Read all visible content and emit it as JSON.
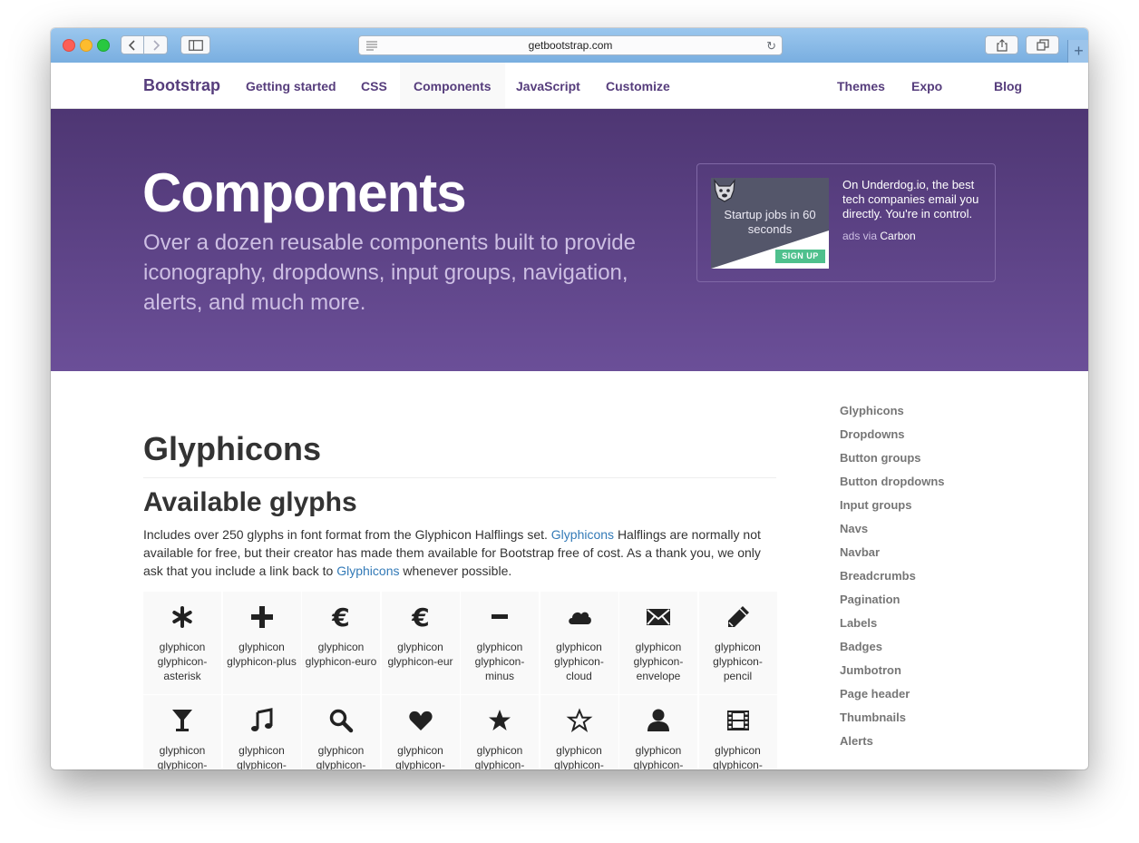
{
  "browser": {
    "url": "getbootstrap.com"
  },
  "navbar": {
    "brand": "Bootstrap",
    "left_items": [
      "Getting started",
      "CSS",
      "Components",
      "JavaScript",
      "Customize"
    ],
    "right_items": [
      "Themes",
      "Expo",
      "Blog"
    ],
    "active": "Components"
  },
  "hero": {
    "title": "Components",
    "lead": "Over a dozen reusable components built to provide iconography, dropdowns, input groups, navigation, alerts, and much more."
  },
  "ad": {
    "image_text": "Startup jobs in 60 seconds",
    "image_button": "SIGN UP",
    "text": "On Underdog.io, the best tech companies email you directly. You're in control.",
    "via_prefix": "ads via",
    "via_link": "Carbon"
  },
  "main": {
    "title": "Glyphicons",
    "subtitle": "Available glyphs",
    "intro_part1": "Includes over 250 glyphs in font format from the Glyphicon Halflings set.",
    "intro_link1": "Glyphicons",
    "intro_part2": "Halflings are normally not available for free, but their creator has made them available for Bootstrap free of cost. As a thank you, we only ask that you include a link back to",
    "intro_link2": "Glyphicons",
    "intro_part3": "whenever possible."
  },
  "glyphs": [
    {
      "icon": "asterisk-icon",
      "label": "glyphicon glyphicon-asterisk"
    },
    {
      "icon": "plus-icon",
      "label": "glyphicon glyphicon-plus"
    },
    {
      "icon": "euro-icon",
      "label": "glyphicon glyphicon-euro"
    },
    {
      "icon": "eur-icon",
      "label": "glyphicon glyphicon-eur"
    },
    {
      "icon": "minus-icon",
      "label": "glyphicon glyphicon-minus"
    },
    {
      "icon": "cloud-icon",
      "label": "glyphicon glyphicon-cloud"
    },
    {
      "icon": "envelope-icon",
      "label": "glyphicon glyphicon-envelope"
    },
    {
      "icon": "pencil-icon",
      "label": "glyphicon glyphicon-pencil"
    },
    {
      "icon": "glass-icon",
      "label": "glyphicon glyphicon-"
    },
    {
      "icon": "music-icon",
      "label": "glyphicon glyphicon-"
    },
    {
      "icon": "search-icon",
      "label": "glyphicon glyphicon-"
    },
    {
      "icon": "heart-icon",
      "label": "glyphicon glyphicon-"
    },
    {
      "icon": "star-icon",
      "label": "glyphicon glyphicon-"
    },
    {
      "icon": "star-empty-icon",
      "label": "glyphicon glyphicon-"
    },
    {
      "icon": "user-icon",
      "label": "glyphicon glyphicon-"
    },
    {
      "icon": "film-icon",
      "label": "glyphicon glyphicon-"
    }
  ],
  "sidenav": [
    "Glyphicons",
    "Dropdowns",
    "Button groups",
    "Button dropdowns",
    "Input groups",
    "Navs",
    "Navbar",
    "Breadcrumbs",
    "Pagination",
    "Labels",
    "Badges",
    "Jumbotron",
    "Page header",
    "Thumbnails",
    "Alerts"
  ]
}
